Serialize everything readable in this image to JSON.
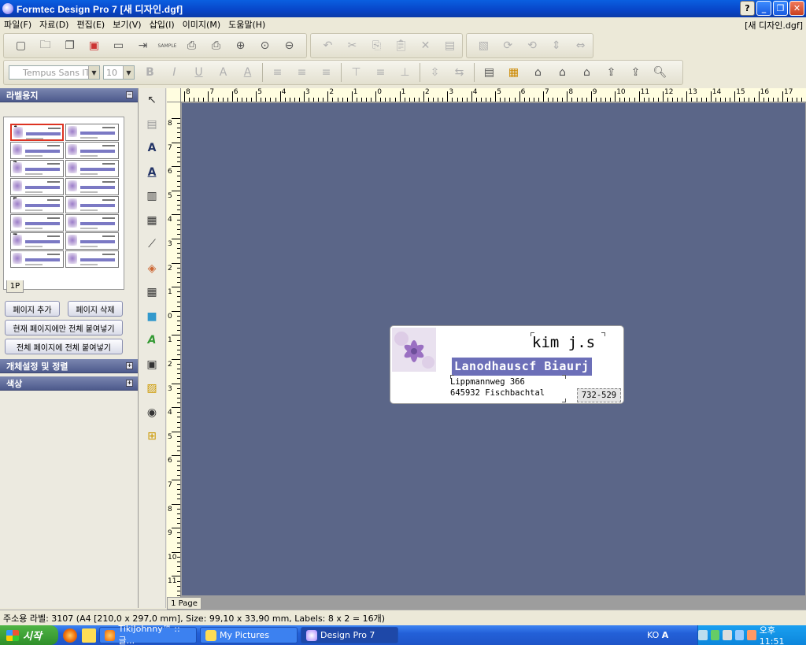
{
  "window": {
    "title": "Formtec Design Pro 7 [새 디자인.dgf]",
    "doc_name": "[새 디자인.dgf]",
    "buttons": [
      "?",
      "_",
      "❐",
      "✕"
    ]
  },
  "menu": [
    "파일(F)",
    "자료(D)",
    "편집(E)",
    "보기(V)",
    "삽입(I)",
    "이미지(M)",
    "도움말(H)"
  ],
  "toolbar": {
    "font_name": "Tempus Sans ITC",
    "font_size": "10",
    "sample_label": "SAMPLE"
  },
  "left_panel": {
    "label_sheet_header": "라벨용지",
    "page_tab": "1P",
    "thumb_numbers": [
      "1",
      "3",
      "5",
      "7"
    ],
    "add_page": "페이지 추가",
    "delete_page": "페이지 삭제",
    "paste_current": "현재 페이지에만 전체 붙여넣기",
    "paste_all": "전체 페이지에 전체 붙여넣기",
    "object_header": "개체설정 및 정렬",
    "color_header": "색상"
  },
  "canvas": {
    "page_label": "1 Page",
    "hruler_numbers": [
      "8",
      "7",
      "6",
      "5",
      "4",
      "3",
      "2",
      "1",
      "0",
      "1",
      "2",
      "3",
      "4",
      "5",
      "6",
      "7",
      "8",
      "9",
      "10",
      "11",
      "12",
      "13",
      "14",
      "15",
      "16",
      "17"
    ],
    "vruler_numbers": [
      "8",
      "7",
      "6",
      "5",
      "4",
      "3",
      "2",
      "1",
      "0",
      "1",
      "2",
      "3",
      "4",
      "5",
      "6",
      "7",
      "8",
      "9",
      "10",
      "11"
    ]
  },
  "label": {
    "name": "kim j.s",
    "company": "Lanodhauscf Biaurj",
    "address1": "Lippmannweg 366",
    "address2": "645932 Fischbachtal",
    "code": "732-529"
  },
  "status": "주소용 라벨: 3107 (A4 [210,0 x 297,0 mm], Size: 99,10 x 33,90 mm,  Labels: 8 x 2 = 16개)",
  "taskbar": {
    "start": "시작",
    "tasks": [
      "TikiJohnny™ :: 글...",
      "My Pictures",
      "Design Pro 7"
    ],
    "lang": "KO",
    "clock": "오후 11:51"
  }
}
